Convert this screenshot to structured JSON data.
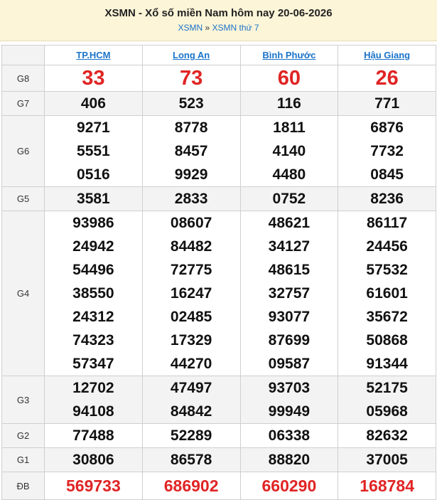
{
  "header": {
    "title": "XSMN - Xổ số miền Nam hôm nay 20-06-2026",
    "crumb1": "XSMN",
    "sep": "»",
    "crumb2": "XSMN thứ 7"
  },
  "provinces": [
    "TP.HCM",
    "Long An",
    "Bình Phước",
    "Hậu Giang"
  ],
  "prizes": [
    {
      "label": "G8",
      "results": [
        [
          "33"
        ],
        [
          "73"
        ],
        [
          "60"
        ],
        [
          "26"
        ]
      ]
    },
    {
      "label": "G7",
      "results": [
        [
          "406"
        ],
        [
          "523"
        ],
        [
          "116"
        ],
        [
          "771"
        ]
      ]
    },
    {
      "label": "G6",
      "results": [
        [
          "9271",
          "5551",
          "0516"
        ],
        [
          "8778",
          "8457",
          "9929"
        ],
        [
          "1811",
          "4140",
          "4480"
        ],
        [
          "6876",
          "7732",
          "0845"
        ]
      ]
    },
    {
      "label": "G5",
      "results": [
        [
          "3581"
        ],
        [
          "2833"
        ],
        [
          "0752"
        ],
        [
          "8236"
        ]
      ]
    },
    {
      "label": "G4",
      "results": [
        [
          "93986",
          "24942",
          "54496",
          "38550",
          "24312",
          "74323",
          "57347"
        ],
        [
          "08607",
          "84482",
          "72775",
          "16247",
          "02485",
          "17329",
          "44270"
        ],
        [
          "48621",
          "34127",
          "48615",
          "32757",
          "93077",
          "87699",
          "09587"
        ],
        [
          "86117",
          "24456",
          "57532",
          "61601",
          "35672",
          "50868",
          "91344"
        ]
      ]
    },
    {
      "label": "G3",
      "results": [
        [
          "12702",
          "94108"
        ],
        [
          "47497",
          "84842"
        ],
        [
          "93703",
          "99949"
        ],
        [
          "52175",
          "05968"
        ]
      ]
    },
    {
      "label": "G2",
      "results": [
        [
          "77488"
        ],
        [
          "52289"
        ],
        [
          "06338"
        ],
        [
          "82632"
        ]
      ]
    },
    {
      "label": "G1",
      "results": [
        [
          "30806"
        ],
        [
          "86578"
        ],
        [
          "88820"
        ],
        [
          "37005"
        ]
      ]
    },
    {
      "label": "ĐB",
      "results": [
        [
          "569733"
        ],
        [
          "686902"
        ],
        [
          "660290"
        ],
        [
          "168784"
        ]
      ]
    }
  ],
  "colors": {
    "special": "#e02424",
    "link": "#1a73c9",
    "header_bg": "#fdf5d8",
    "alt_row": "#f3f3f3"
  }
}
